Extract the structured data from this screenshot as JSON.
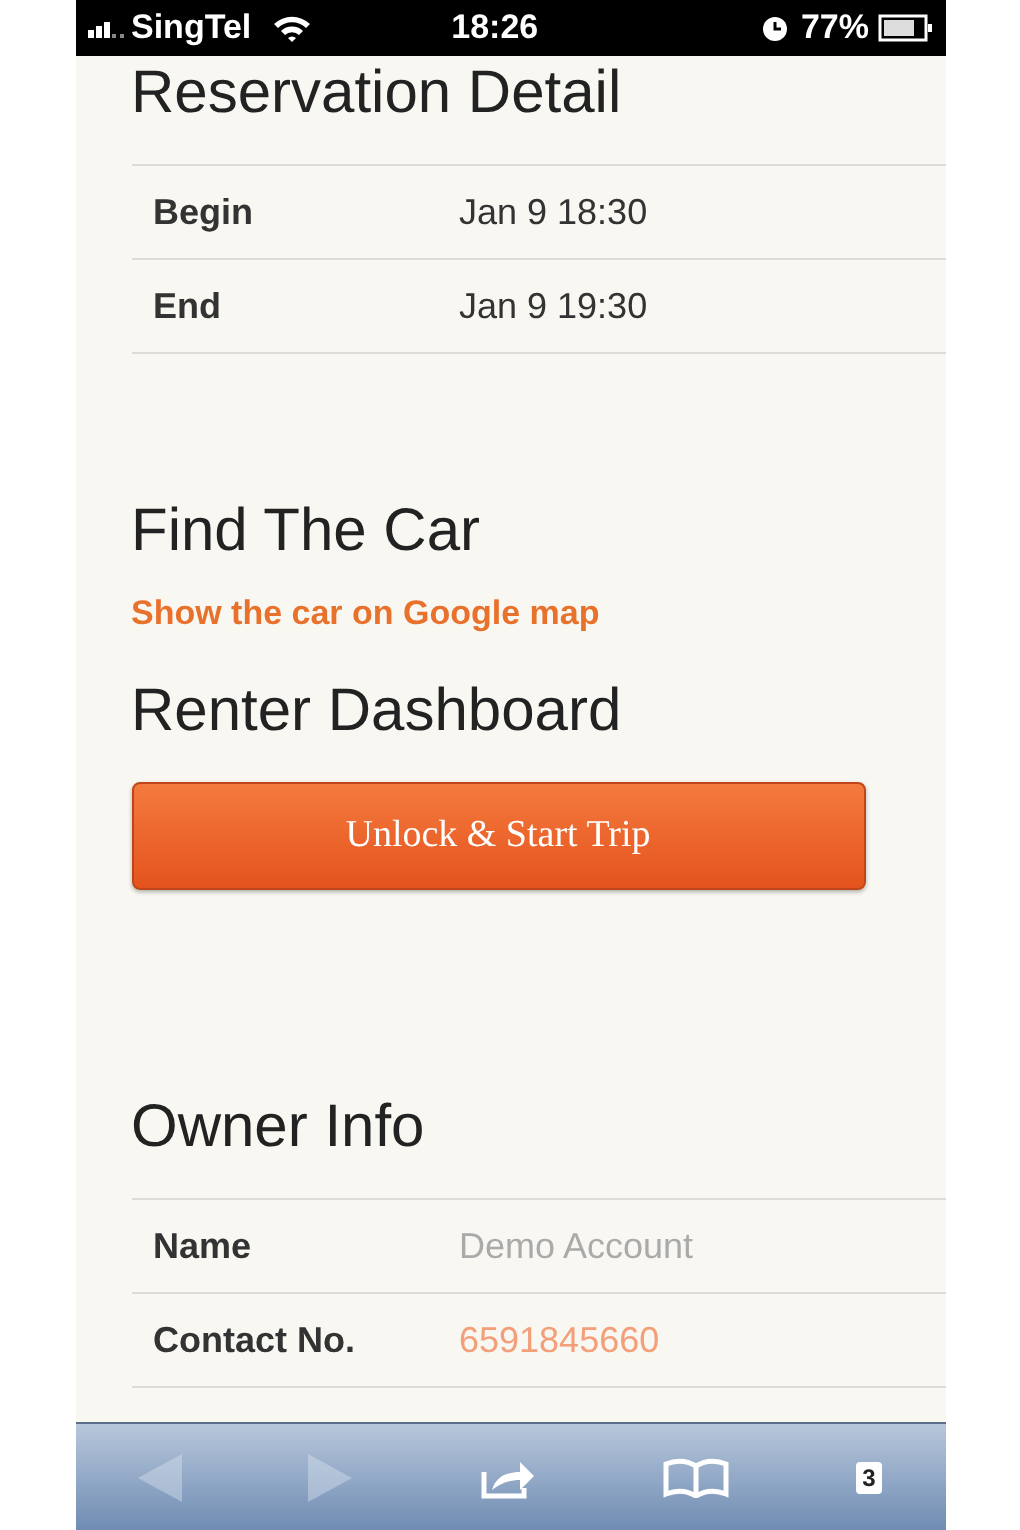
{
  "status_bar": {
    "carrier": "SingTel",
    "time": "18:26",
    "battery": "77%"
  },
  "sections": [
    {
      "kind": "table",
      "title": "Reservation Detail",
      "rows": [
        {
          "label": "Begin",
          "value": "Jan 9 18:30",
          "highlight": false
        },
        {
          "label": "End",
          "value": "Jan 9 19:30",
          "highlight": false
        }
      ]
    },
    {
      "kind": "link",
      "title": "Find The Car",
      "link": "Show the car on Google map"
    },
    {
      "kind": "button",
      "title": "Renter Dashboard",
      "button": "Unlock & Start Trip"
    },
    {
      "kind": "table",
      "title": "Owner Info",
      "rows": [
        {
          "label": "Name",
          "value": "Demo Account",
          "highlight": false
        },
        {
          "label": "Contact No.",
          "value": "6591845660",
          "highlight": true
        }
      ]
    }
  ],
  "toolbar": {
    "back": {
      "disabled": true
    },
    "forward": {
      "disabled": true
    },
    "tab_count": "3"
  }
}
